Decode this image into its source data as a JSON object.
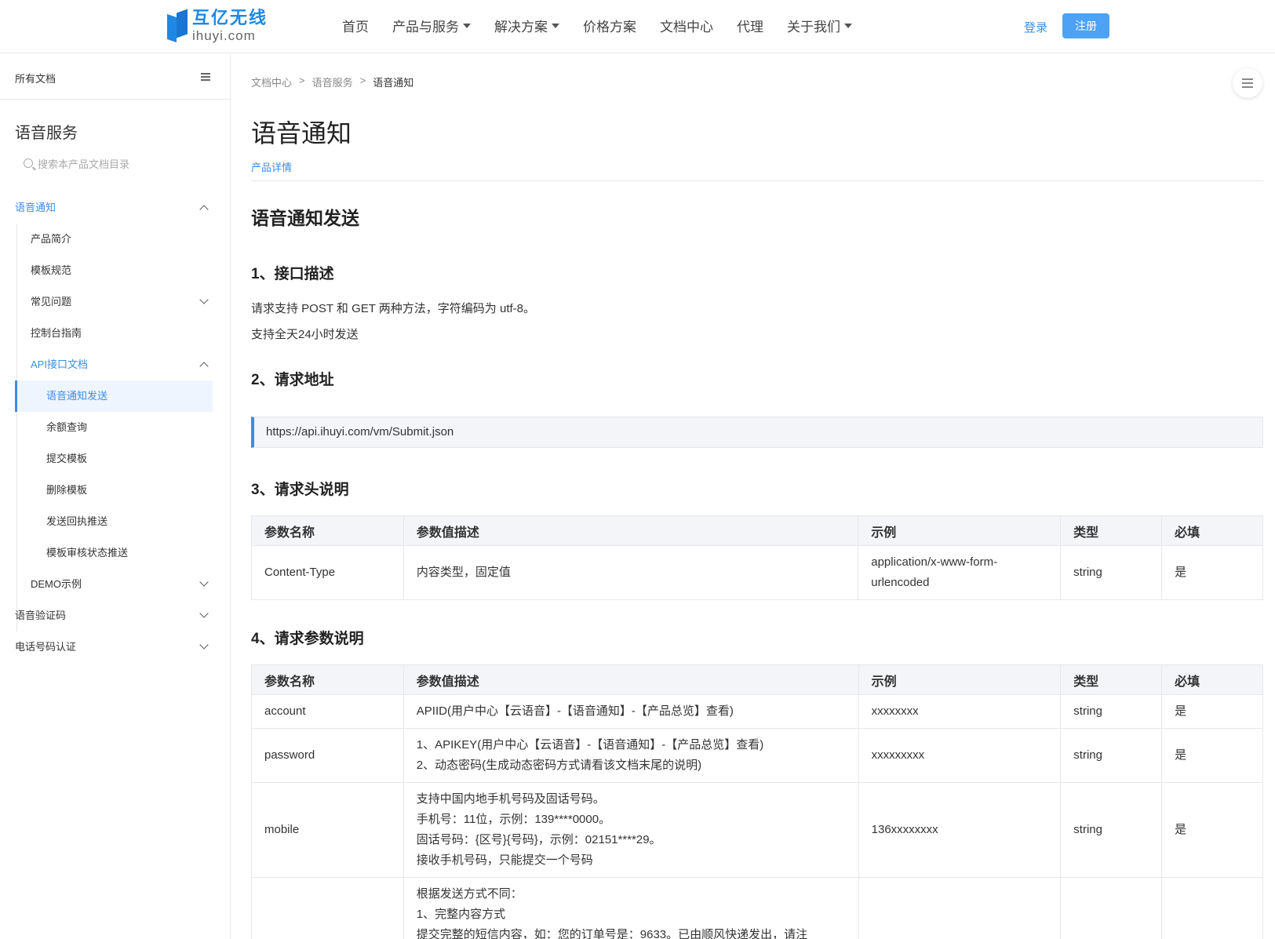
{
  "header": {
    "logo_cn": "互亿无线",
    "logo_en": "ihuyi.com",
    "nav": [
      {
        "label": "首页",
        "dropdown": false
      },
      {
        "label": "产品与服务",
        "dropdown": true
      },
      {
        "label": "解决方案",
        "dropdown": true
      },
      {
        "label": "价格方案",
        "dropdown": false
      },
      {
        "label": "文档中心",
        "dropdown": false
      },
      {
        "label": "代理",
        "dropdown": false
      },
      {
        "label": "关于我们",
        "dropdown": true
      }
    ],
    "login": "登录",
    "register": "注册"
  },
  "sidebar": {
    "all_docs": "所有文档",
    "title": "语音服务",
    "search_placeholder": "搜索本产品文档目录",
    "items": [
      {
        "label": "语音通知"
      },
      {
        "label": "产品简介"
      },
      {
        "label": "模板规范"
      },
      {
        "label": "常见问题"
      },
      {
        "label": "控制台指南"
      },
      {
        "label": "API接口文档"
      },
      {
        "label": "语音通知发送"
      },
      {
        "label": "余额查询"
      },
      {
        "label": "提交模板"
      },
      {
        "label": "删除模板"
      },
      {
        "label": "发送回执推送"
      },
      {
        "label": "模板审核状态推送"
      },
      {
        "label": "DEMO示例"
      },
      {
        "label": "语音验证码"
      },
      {
        "label": "电话号码认证"
      }
    ]
  },
  "breadcrumb": [
    "文档中心",
    "语音服务",
    "语音通知"
  ],
  "breadcrumb_sep": ">",
  "page": {
    "title": "语音通知",
    "detail_link": "产品详情",
    "section_title": "语音通知发送",
    "s1_title": "1、接口描述",
    "s1_p1": "请求支持 POST 和 GET 两种方法，字符编码为 utf-8。",
    "s1_p2": "支持全天24小时发送",
    "s2_title": "2、请求地址",
    "url": "https://api.ihuyi.com/vm/Submit.json",
    "s3_title": "3、请求头说明",
    "s4_title": "4、请求参数说明"
  },
  "table_headers": [
    "参数名称",
    "参数值描述",
    "示例",
    "类型",
    "必填"
  ],
  "header_table": [
    {
      "name": "Content-Type",
      "desc": [
        "内容类型，固定值"
      ],
      "example": [
        "application/x-www-form-",
        "urlencoded"
      ],
      "type": "string",
      "required": "是"
    }
  ],
  "param_table": [
    {
      "name": "account",
      "desc": [
        "APIID(用户中心【云语音】-【语音通知】-【产品总览】查看)"
      ],
      "example": [
        "xxxxxxxx"
      ],
      "type": "string",
      "required": "是"
    },
    {
      "name": "password",
      "desc": [
        "1、APIKEY(用户中心【云语音】-【语音通知】-【产品总览】查看)",
        "2、动态密码(生成动态密码方式请看该文档末尾的说明)"
      ],
      "example": [
        "xxxxxxxxx"
      ],
      "type": "string",
      "required": "是"
    },
    {
      "name": "mobile",
      "desc": [
        "支持中国内地手机号码及固话号码。",
        "手机号：11位，示例：139****0000。",
        "固话号码：{区号}{号码}，示例：02151****29。",
        "接收手机号码，只能提交一个号码"
      ],
      "example": [
        "136xxxxxxxx"
      ],
      "type": "string",
      "required": "是"
    },
    {
      "name": "",
      "desc": [
        "根据发送方式不同：",
        "1、完整内容方式",
        "提交完整的短信内容，如：您的订单号是：9633。已由顺风快递发出，请注"
      ],
      "example": [
        ""
      ],
      "type": "",
      "required": ""
    }
  ]
}
